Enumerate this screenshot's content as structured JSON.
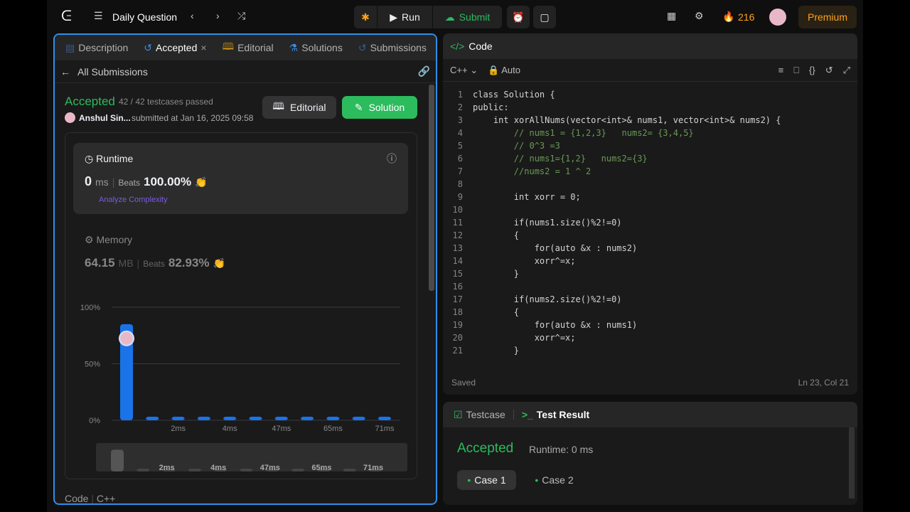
{
  "topbar": {
    "title": "Daily Question",
    "run": "Run",
    "submit": "Submit",
    "streak": "216",
    "premium": "Premium"
  },
  "left": {
    "tabs": [
      {
        "label": "Description"
      },
      {
        "label": "Accepted"
      },
      {
        "label": "Editorial"
      },
      {
        "label": "Solutions"
      },
      {
        "label": "Submissions"
      }
    ],
    "back": "All Submissions",
    "status": "Accepted",
    "testcases": "42 / 42 testcases passed",
    "user": "Anshul Sin...",
    "submitted": "submitted at Jan 16, 2025 09:58",
    "editorial_btn": "Editorial",
    "solution_btn": "Solution",
    "runtime": {
      "label": "Runtime",
      "value": "0",
      "unit": "ms",
      "beats_label": "Beats",
      "beats": "100.00%",
      "analyze": "Analyze Complexity"
    },
    "memory": {
      "label": "Memory",
      "value": "64.15",
      "unit": "MB",
      "beats_label": "Beats",
      "beats": "82.93%"
    },
    "footer": {
      "code": "Code",
      "lang": "C++"
    }
  },
  "chart_data": {
    "type": "bar",
    "categories": [
      "",
      "",
      "2ms",
      "",
      "4ms",
      "",
      "47ms",
      "",
      "65ms",
      "",
      "71ms"
    ],
    "values": [
      85,
      1,
      1,
      1,
      1,
      1,
      1,
      1,
      1,
      1,
      1
    ],
    "ylim": [
      0,
      100
    ],
    "yticks": [
      "0%",
      "50%",
      "100%"
    ],
    "grid": true,
    "color": "#1a73e8"
  },
  "editor": {
    "title": "Code",
    "lang": "C++",
    "mode": "Auto",
    "saved": "Saved",
    "cursor": "Ln 23, Col 21",
    "lines": [
      "class Solution {",
      "public:",
      "    int xorAllNums(vector<int>& nums1, vector<int>& nums2) {",
      "        // nums1 = {1,2,3}   nums2= {3,4,5}",
      "        // 0^3 =3",
      "        // nums1={1,2}   nums2={3}",
      "        //nums2 = 1 ^ 2",
      "",
      "        int xorr = 0;",
      "",
      "        if(nums1.size()%2!=0)",
      "        {",
      "            for(auto &x : nums2)",
      "            xorr^=x;",
      "        }",
      "",
      "        if(nums2.size()%2!=0)",
      "        {",
      "            for(auto &x : nums1)",
      "            xorr^=x;",
      "        }"
    ]
  },
  "result": {
    "tab_testcase": "Testcase",
    "tab_result": "Test Result",
    "status": "Accepted",
    "runtime": "Runtime: 0 ms",
    "cases": [
      "Case 1",
      "Case 2"
    ]
  },
  "colors": {
    "accent": "#2cbb5d",
    "blue": "#1a73e8",
    "premium": "#ffa116"
  }
}
